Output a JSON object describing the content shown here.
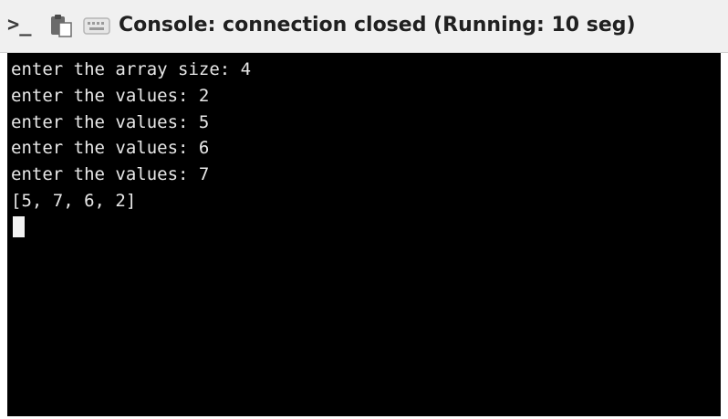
{
  "titlebar": {
    "title": "Console: connection closed (Running: 10 seg)",
    "icons": [
      "terminal-prompt-icon",
      "clipboard-icon",
      "keyboard-icon"
    ],
    "prompt_glyph": ">_"
  },
  "console": {
    "lines": [
      "enter the array size: 4",
      "enter the values: 2",
      "enter the values: 5",
      "enter the values: 6",
      "enter the values: 7",
      "[5, 7, 6, 2]"
    ]
  },
  "colors": {
    "terminal_background": "#000000",
    "terminal_text": "#e8e8e8",
    "titlebar_background": "#f0f0f0",
    "title_text": "#202020"
  }
}
